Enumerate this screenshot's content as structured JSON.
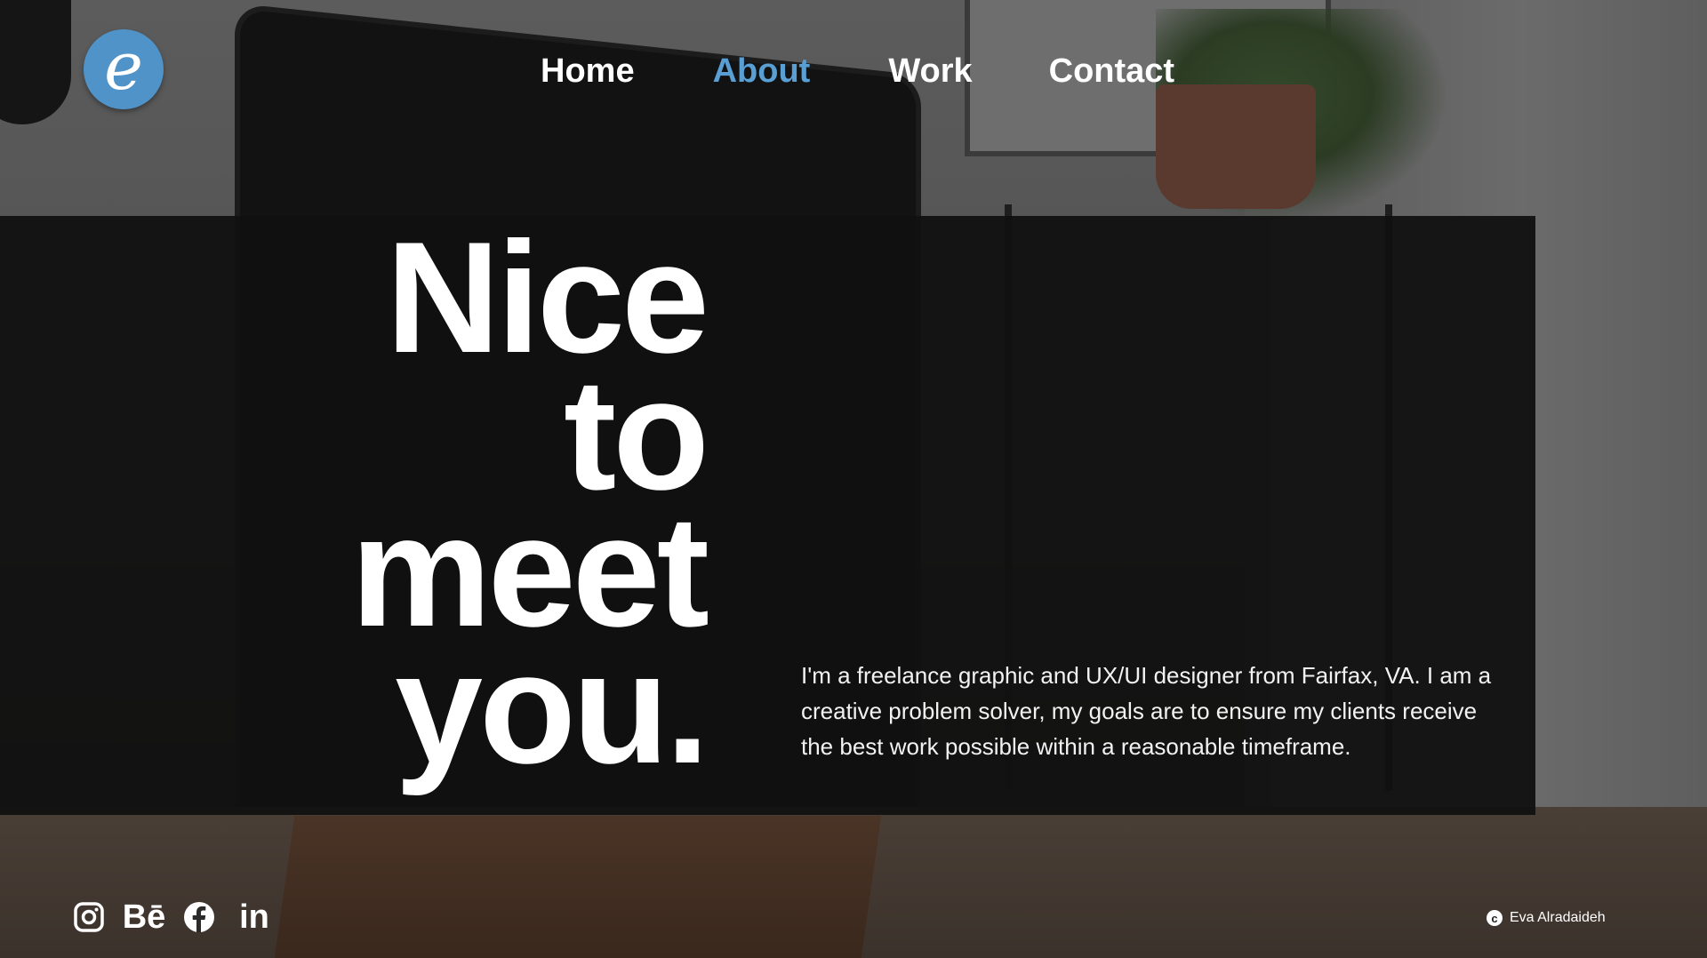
{
  "logo": {
    "letter": "e"
  },
  "nav": {
    "items": [
      "Home",
      "About",
      "Work",
      "Contact"
    ],
    "active": "About",
    "active_color": "#5a9fd4"
  },
  "hero": {
    "headline_lines": [
      "Nice",
      "to",
      "meet",
      "you."
    ],
    "about_text": "I'm a freelance graphic and UX/UI designer from Fairfax, VA.  I am a creative problem solver, my goals are to ensure my clients receive the best work possible within a reasonable timeframe."
  },
  "social": {
    "icons": [
      "instagram-icon",
      "behance-icon",
      "facebook-icon",
      "linkedin-icon"
    ],
    "behance_label": "Bē",
    "linkedin_label": "in"
  },
  "footer": {
    "copyright_symbol": "c",
    "copyright_name": "Eva Alradaideh"
  },
  "colors": {
    "logo_bg": "#4f93c9",
    "band": "#111111"
  }
}
